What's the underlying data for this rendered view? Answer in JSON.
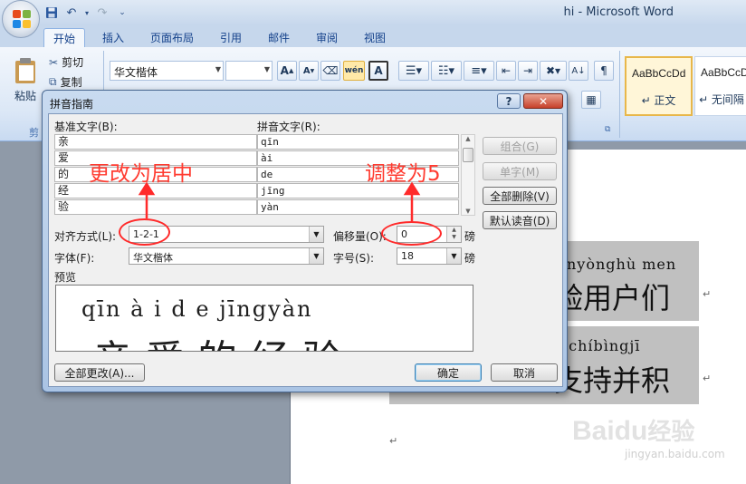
{
  "window": {
    "title": "hi - Microsoft Word"
  },
  "tabs": [
    {
      "label": "开始",
      "active": true
    },
    {
      "label": "插入"
    },
    {
      "label": "页面布局"
    },
    {
      "label": "引用"
    },
    {
      "label": "邮件"
    },
    {
      "label": "审阅"
    },
    {
      "label": "视图"
    }
  ],
  "ribbon": {
    "paste_label": "粘贴",
    "cut_label": "剪切",
    "copy_label": "复制",
    "clipboard_group_label": "剪",
    "font_name": "华文楷体",
    "font_size": "",
    "phonetic_btn_label": "wén",
    "styles": [
      {
        "sample": "AaBbCcDd",
        "name": "↵ 正文",
        "selected": true
      },
      {
        "sample": "AaBbCcDd",
        "name": "↵ 无间隔"
      }
    ]
  },
  "document": {
    "block1": {
      "pinyin": "nyònghù men",
      "hanzi": "验用户们"
    },
    "block2": {
      "pinyin": "ichíbìngjī",
      "hanzi": "支持并积"
    },
    "para_mark": "↵"
  },
  "dialog": {
    "title": "拼音指南",
    "help_label": "?",
    "close_label": "✕",
    "base_text_header": "基准文字(B):",
    "ruby_text_header": "拼音文字(R):",
    "rows": [
      {
        "base": "亲",
        "ruby": "qīn"
      },
      {
        "base": "爱",
        "ruby": "ài"
      },
      {
        "base": "的",
        "ruby": "de"
      },
      {
        "base": "经",
        "ruby": "jīng"
      },
      {
        "base": "验",
        "ruby": "yàn"
      }
    ],
    "buttons": {
      "group": "组合(G)",
      "mono": "单字(M)",
      "clear_all": "全部删除(V)",
      "default_reading": "默认读音(D)",
      "change_all": "全部更改(A)...",
      "ok": "确定",
      "cancel": "取消"
    },
    "alignment_label": "对齐方式(L):",
    "alignment_value": "1-2-1",
    "offset_label": "偏移量(O):",
    "offset_value": "0",
    "offset_unit": "磅",
    "font_label": "字体(F):",
    "font_value": "华文楷体",
    "size_label": "字号(S):",
    "size_value": "18",
    "size_unit": "磅",
    "preview_label": "预览",
    "preview_pinyin": "qīn à i d e jīngyàn",
    "preview_hanzi": "亲爱的经验"
  },
  "annotations": {
    "left": "更改为居中",
    "right": "调整为5"
  },
  "watermark": {
    "brand": "Baidu",
    "brand_cn": "经验",
    "url": "jingyan.baidu.com"
  }
}
